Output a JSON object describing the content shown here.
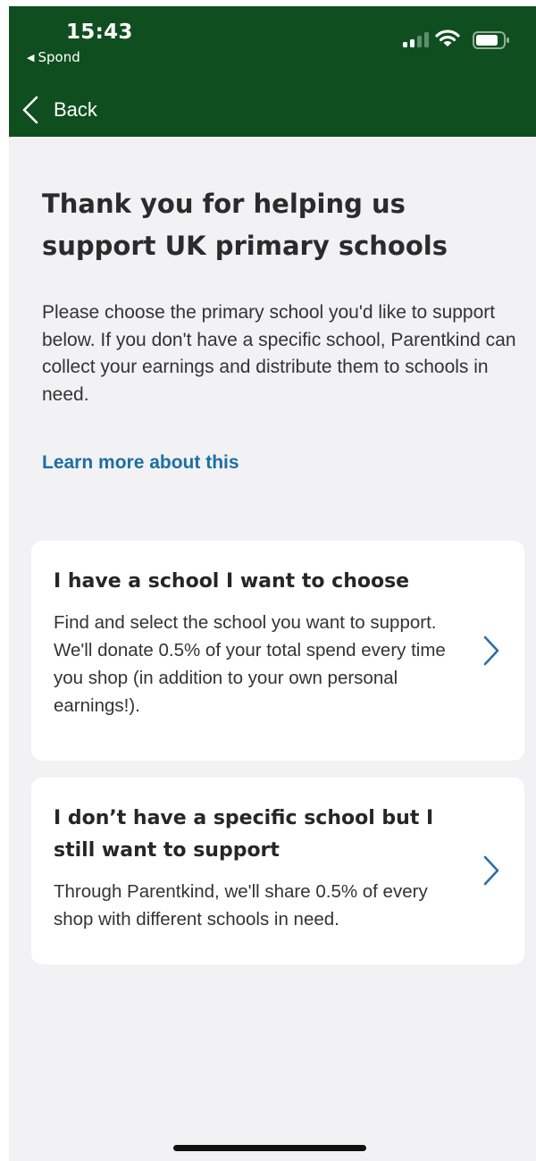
{
  "status_bar": {
    "time": "15:43",
    "back_app": "Spond",
    "icons": [
      "cellular-signal-icon",
      "wifi-icon",
      "battery-icon"
    ]
  },
  "nav": {
    "back_label": "Back",
    "back_icon": "chevron-left-icon"
  },
  "main": {
    "title": "Thank you for helping us support UK primary schools",
    "intro": "Please choose the primary school you'd like to support below. If you don't have a specific school, Parentkind can collect your earnings and distribute them to schools in need.",
    "learn_more": "Learn more about this"
  },
  "options": [
    {
      "title": "I have a school I want to choose",
      "description": "Find and select the school you want to support. We'll donate 0.5% of your total spend every time you shop (in addition to your own personal earnings!).",
      "icon": "chevron-right-icon"
    },
    {
      "title": "I don’t have a specific school but I still want to support",
      "description": "Through Parentkind, we'll share 0.5% of every shop with different schools in need.",
      "icon": "chevron-right-icon"
    }
  ],
  "colors": {
    "header_bg": "#0f4f1f",
    "page_bg": "#f2f2f4",
    "link": "#1c6fa2",
    "chevron": "#2a6fa8"
  }
}
